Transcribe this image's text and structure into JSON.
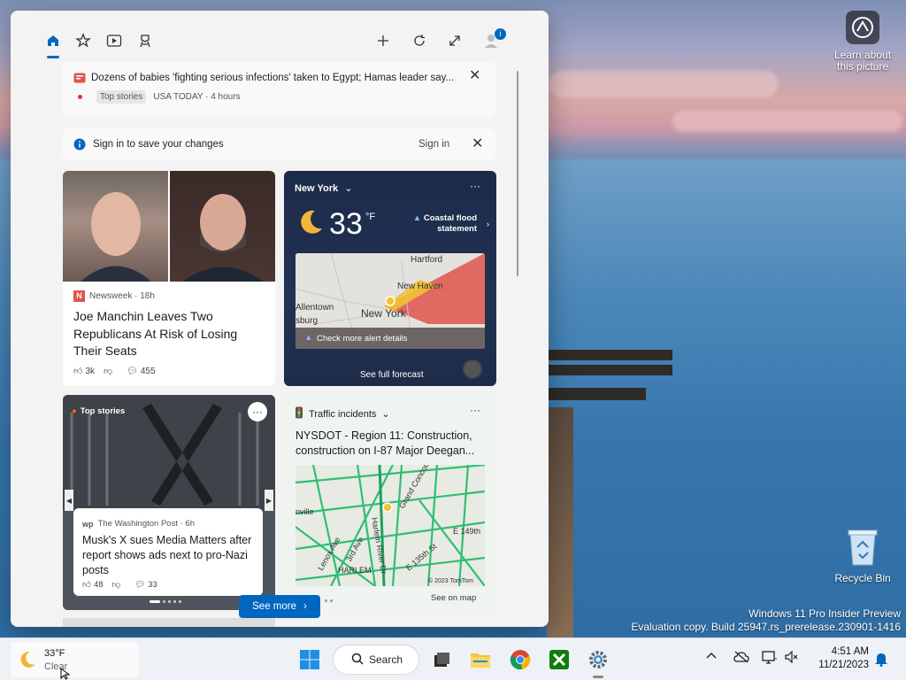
{
  "desktop": {
    "learn_picture": "Learn about this picture",
    "recycle_bin": "Recycle Bin",
    "watermark_line1": "Windows 11 Pro Insider Preview",
    "watermark_line2": "Evaluation copy. Build 25947.rs_prerelease.230901-1416"
  },
  "widgets": {
    "topbar": {
      "icons": [
        "home-icon",
        "favorites-icon",
        "video-icon",
        "sports-icon"
      ],
      "right_icons": [
        "add-icon",
        "refresh-icon",
        "expand-icon",
        "account-icon"
      ],
      "badge": "i"
    },
    "news_banner": {
      "title": "Dozens of babies 'fighting serious infections' taken to Egypt; Hamas leader say...",
      "tag": "Top stories",
      "source": "USA TODAY · 4 hours"
    },
    "signin": {
      "text": "Sign in to save your changes",
      "link": "Sign in"
    },
    "article": {
      "source_letter": "N",
      "source": "Newsweek · 18h",
      "headline": "Joe Manchin Leaves Two Republicans At Risk of Losing Their Seats",
      "likes": "3k",
      "comments": "455"
    },
    "weather": {
      "location": "New York",
      "temp": "33",
      "unit": "°F",
      "alert": "Coastal flood statement",
      "map_labels": [
        "Hartford",
        "New Haven",
        "Allentown",
        "New York",
        "sburg"
      ],
      "map_button": "Check more alert details",
      "forecast": "See full forecast",
      "more": "···"
    },
    "stories": {
      "label": "Top stories",
      "source": "The Washington Post · 6h",
      "headline": "Musk's X sues Media Matters after report shows ads next to pro-Nazi posts",
      "likes": "48",
      "comments": "33",
      "more": "···"
    },
    "traffic": {
      "title": "Traffic incidents",
      "headline": "NYSDOT - Region 11: Construction, construction on I-87 Major Deegan...",
      "map_labels": [
        "Harlem River Dr",
        "Grand Concourse",
        "E 149th",
        "Lenox Ave",
        "HARLEM",
        "nville",
        "3rd Ave",
        "E 135th St",
        "© 2023 TomTom"
      ],
      "see_map": "See on map",
      "more": "···"
    },
    "see_more": "See more"
  },
  "taskbar": {
    "weather_temp": "33°F",
    "weather_cond": "Clear",
    "search": "Search",
    "time": "4:51 AM",
    "date": "11/21/2023"
  },
  "colors": {
    "accent": "#0067c0",
    "weather_card": "#1e2c49",
    "alert_red": "#e0544c"
  }
}
